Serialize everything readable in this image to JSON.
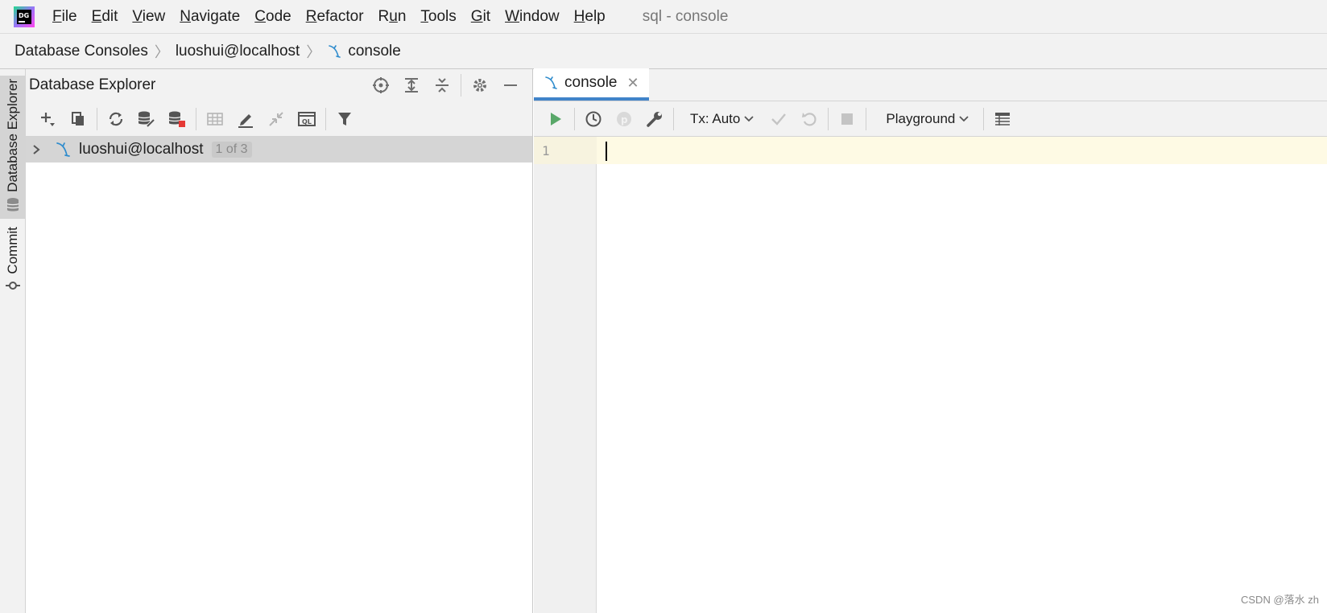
{
  "menubar": {
    "items": [
      {
        "accel": "F",
        "rest": "ile"
      },
      {
        "accel": "E",
        "rest": "dit"
      },
      {
        "accel": "V",
        "rest": "iew"
      },
      {
        "accel": "N",
        "rest": "avigate"
      },
      {
        "accel": "C",
        "rest": "ode"
      },
      {
        "accel": "R",
        "rest": "efactor"
      },
      {
        "pre": "R",
        "accel": "u",
        "rest": "n"
      },
      {
        "accel": "T",
        "rest": "ools"
      },
      {
        "accel": "G",
        "rest": "it"
      },
      {
        "accel": "W",
        "rest": "indow"
      },
      {
        "accel": "H",
        "rest": "elp"
      }
    ],
    "window_title": "sql - console",
    "logo_text": "DG"
  },
  "breadcrumb": {
    "items": [
      "Database Consoles",
      "luoshui@localhost",
      "console"
    ]
  },
  "toolstrip": {
    "database_explorer": "Database Explorer",
    "commit": "Commit"
  },
  "explorer": {
    "title": "Database Explorer",
    "tree": [
      {
        "label": "luoshui@localhost",
        "badge": "1 of 3"
      }
    ]
  },
  "editor": {
    "tab_label": "console",
    "tx_label": "Tx: Auto",
    "playground_label": "Playground",
    "line_numbers": [
      "1"
    ]
  },
  "watermark": "CSDN @落水 zh",
  "colors": {
    "run_green": "#59a869",
    "tab_underline": "#4083c9",
    "current_line": "#fefae4",
    "mysql_blue": "#2f8ccd"
  }
}
